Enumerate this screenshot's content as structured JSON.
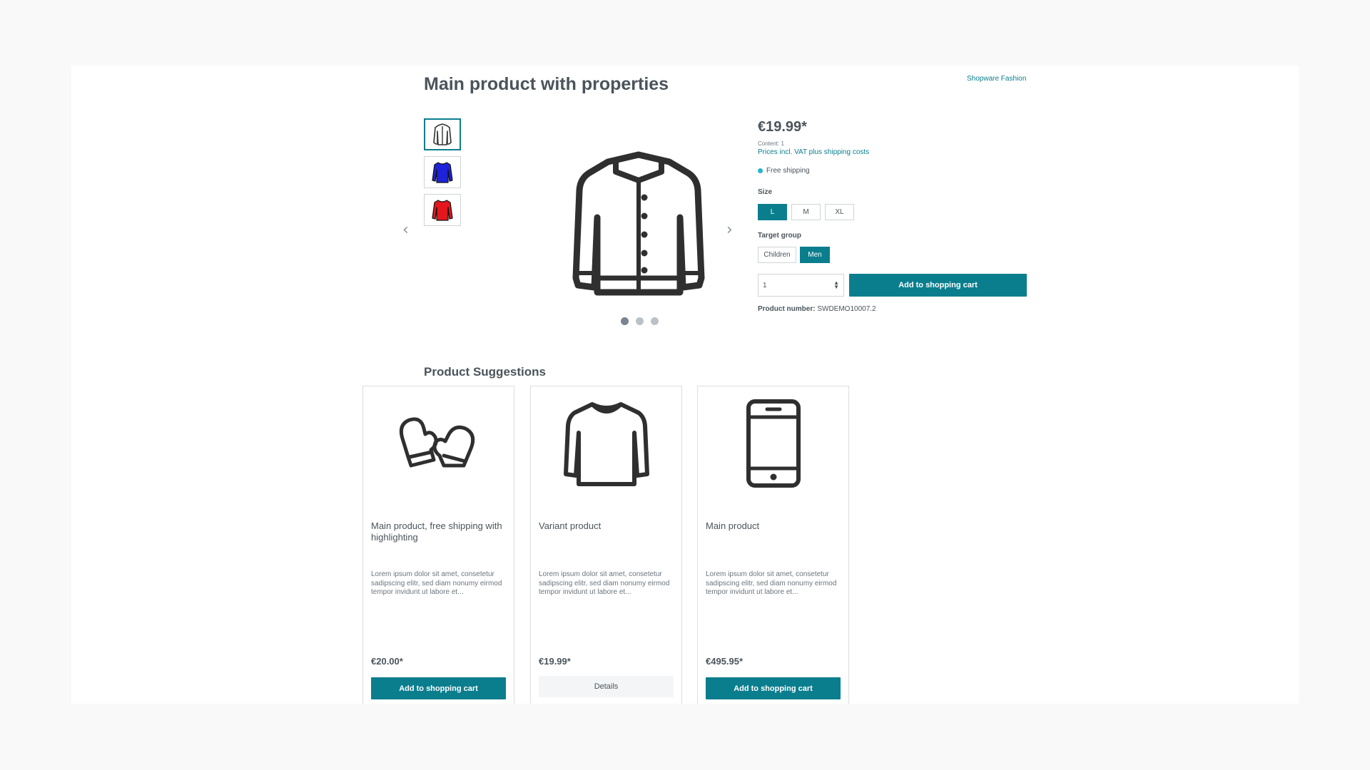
{
  "header": {
    "title": "Main product with properties",
    "manufacturer": "Shopware Fashion"
  },
  "gallery": {
    "thumbnails": [
      "jacket-outline-icon",
      "shirt-blue-icon",
      "shirt-red-icon"
    ],
    "main_image": "jacket-outline-icon",
    "dots_count": 3,
    "active_dot": 0
  },
  "buybox": {
    "price": "€19.99*",
    "content": "Content: 1",
    "vat_link": "Prices incl. VAT plus shipping costs",
    "shipping": "Free shipping",
    "size_label": "Size",
    "size_options": [
      "L",
      "M",
      "XL"
    ],
    "size_selected": "L",
    "target_label": "Target group",
    "target_options": [
      "Children",
      "Men"
    ],
    "target_selected": "Men",
    "quantity": "1",
    "add_to_cart": "Add to shopping cart",
    "product_number_label": "Product number:",
    "product_number": "SWDEMO10007.2"
  },
  "suggestions": {
    "title": "Product Suggestions",
    "cards": [
      {
        "name": "Main product, free shipping with highlighting",
        "description": "Lorem ipsum dolor sit amet, consetetur sadipscing elitr, sed diam nonumy eirmod tempor invidunt ut labore et...",
        "price": "€20.00*",
        "button": "Add to shopping cart",
        "icon": "mittens-icon"
      },
      {
        "name": "Variant product",
        "description": "Lorem ipsum dolor sit amet, consetetur sadipscing elitr, sed diam nonumy eirmod tempor invidunt ut labore et...",
        "price": "€19.99*",
        "button": "Details",
        "icon": "sweater-icon"
      },
      {
        "name": "Main product",
        "description": "Lorem ipsum dolor sit amet, consetetur sadipscing elitr, sed diam nonumy eirmod tempor invidunt ut labore et...",
        "price": "€495.95*",
        "button": "Add to shopping cart",
        "icon": "smartphone-icon"
      }
    ]
  },
  "colors": {
    "accent": "#0b7e8e",
    "text": "#4a545b",
    "background": "#f9f9f9"
  }
}
